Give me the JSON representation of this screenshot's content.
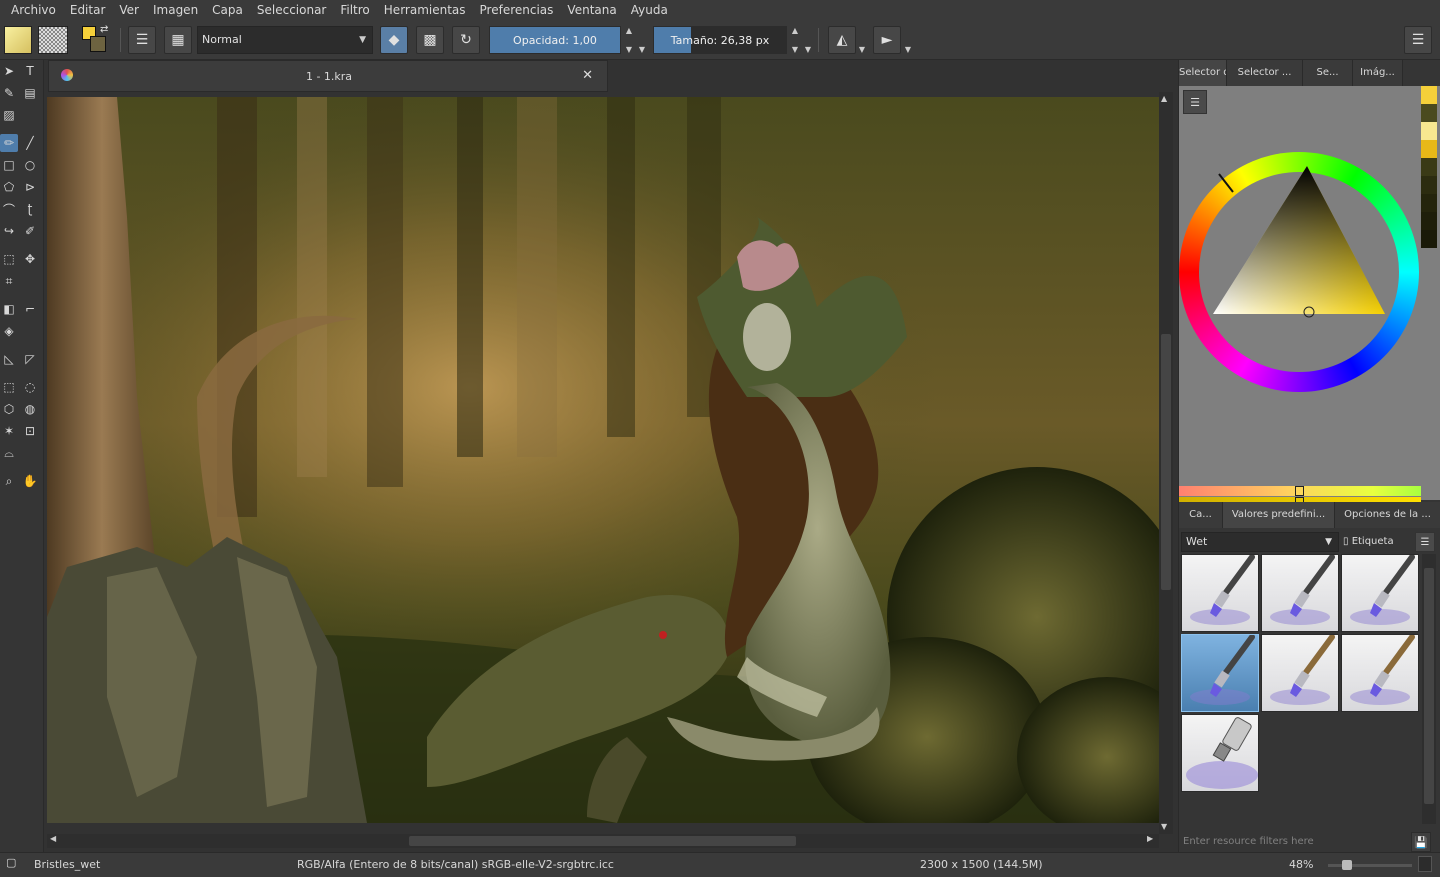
{
  "menu": [
    "Archivo",
    "Editar",
    "Ver",
    "Imagen",
    "Capa",
    "Seleccionar",
    "Filtro",
    "Herramientas",
    "Preferencias",
    "Ventana",
    "Ayuda"
  ],
  "toolbar": {
    "blend_mode": "Normal",
    "opacity_label": "Opacidad:  1,00",
    "opacity_value": 1.0,
    "size_label": "Tamaño:  26,38 px",
    "size_value": 26.38,
    "colors": {
      "foreground": "#f5d03a",
      "background": "#6d6340",
      "accent": "#4f7dab"
    }
  },
  "document": {
    "tab_title": "1 - 1.kra"
  },
  "dockers": {
    "top_tabs": [
      "Selector d...",
      "Selector ...",
      "Se...",
      "Imág..."
    ],
    "bottom_tabs": [
      "Ca...",
      "Valores predefini...",
      "Opciones de la ..."
    ],
    "preset_tag": "Wet",
    "tag_button": "Etiqueta",
    "filter_placeholder": "Enter resource filters here"
  },
  "status": {
    "preset_name": "Bristles_wet",
    "color_space": "RGB/Alfa (Entero de 8 bits/canal)  sRGB-elle-V2-srgbtrc.icc",
    "image_size": "2300 x 1500 (144.5M)",
    "zoom": "48%"
  }
}
